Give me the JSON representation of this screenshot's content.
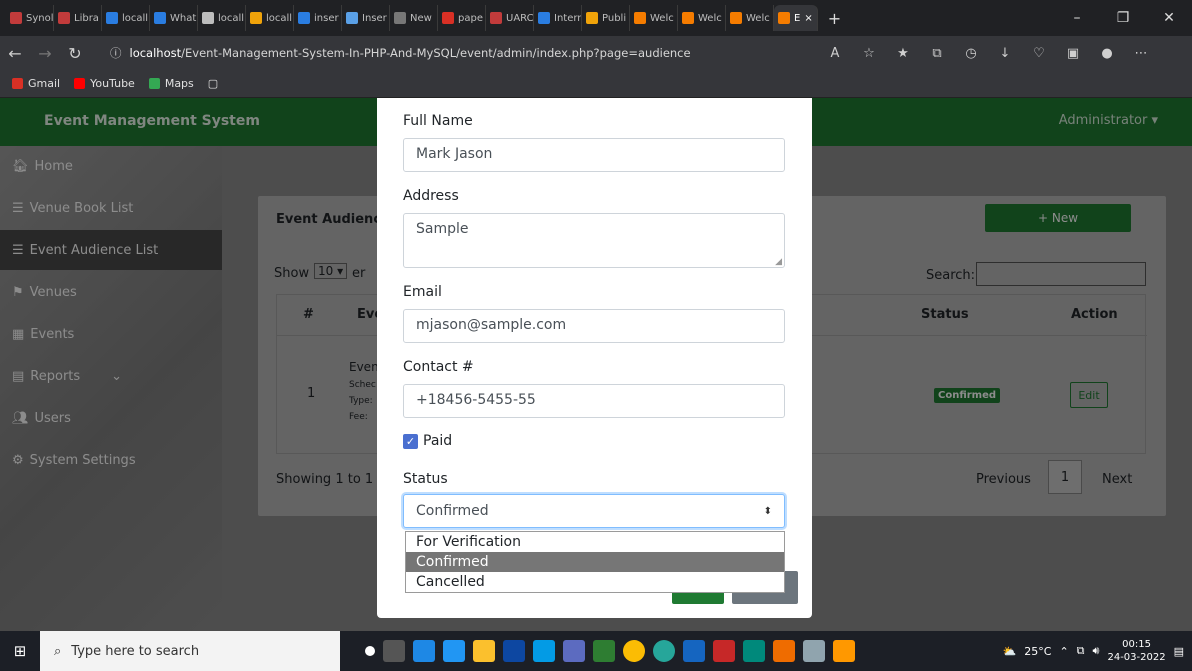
{
  "browser": {
    "tabs": [
      {
        "label": "Synol",
        "color": "#c23b3b"
      },
      {
        "label": "Libra",
        "color": "#c23b3b"
      },
      {
        "label": "locall",
        "color": "#2a7de1"
      },
      {
        "label": "What",
        "color": "#2a7de1"
      },
      {
        "label": "locall",
        "color": "#bdbdbd"
      },
      {
        "label": "locall",
        "color": "#f0a30a"
      },
      {
        "label": "inser",
        "color": "#2a7de1"
      },
      {
        "label": "Inser",
        "color": "#5aa0e6"
      },
      {
        "label": "New",
        "color": "#777777"
      },
      {
        "label": "pape",
        "color": "#d93025"
      },
      {
        "label": "UARC",
        "color": "#c23b3b"
      },
      {
        "label": "Intern",
        "color": "#2a7de1"
      },
      {
        "label": "Publi",
        "color": "#f0a30a"
      },
      {
        "label": "Welc",
        "color": "#f57c00"
      },
      {
        "label": "Welc",
        "color": "#f57c00"
      },
      {
        "label": "Welc",
        "color": "#f57c00"
      }
    ],
    "active_tab": {
      "label": "E",
      "close": "×"
    },
    "new_tab": "+",
    "window_controls": {
      "minimize": "–",
      "restore": "❐",
      "close": "✕"
    },
    "url_host": "localhost",
    "url_path": "/Event-Management-System-In-PHP-And-MySQL/event/admin/index.php?page=audience",
    "bookmarks": [
      {
        "label": "Gmail",
        "color": "#d93025"
      },
      {
        "label": "YouTube",
        "color": "#ff0000"
      },
      {
        "label": "Maps",
        "color": "#34a853"
      }
    ]
  },
  "app": {
    "brand": "Event Management System",
    "user_menu": "Administrator ▾",
    "sidebar": [
      {
        "label": "Home",
        "icon": "🏠︎"
      },
      {
        "label": "Venue Book List",
        "icon": "☰"
      },
      {
        "label": "Event Audience List",
        "icon": "☰"
      },
      {
        "label": "Venues",
        "icon": "⚑"
      },
      {
        "label": "Events",
        "icon": "▦"
      },
      {
        "label": "Reports",
        "icon": "▤"
      },
      {
        "label": "Users",
        "icon": "👥︎"
      },
      {
        "label": "System Settings",
        "icon": "⚙"
      }
    ],
    "card_title": "Event Audience",
    "new_button": "+ New",
    "show_label": "Show",
    "show_value": "10",
    "show_suffix": "er",
    "search_label": "Search:",
    "table_headers": {
      "num": "#",
      "event": "Eve",
      "status": "Status",
      "action": "Action"
    },
    "row": {
      "num": "1",
      "event": "Even",
      "schedule": "Schec",
      "type": "Type:",
      "fee": "Fee: ",
      "status": "Confirmed",
      "action": "Edit"
    },
    "showing_info": "Showing 1 to 1 o",
    "pagination": {
      "prev": "Previous",
      "page": "1",
      "next": "Next"
    }
  },
  "modal": {
    "full_name_label": "Full Name",
    "full_name_value": "Mark Jason",
    "address_label": "Address",
    "address_value": "Sample",
    "email_label": "Email",
    "email_value": "mjason@sample.com",
    "contact_label": "Contact #",
    "contact_value": "+18456-5455-55",
    "paid_label": "Paid",
    "paid_checked": true,
    "status_label": "Status",
    "status_value": "Confirmed",
    "status_options": [
      "For Verification",
      "Confirmed",
      "Cancelled"
    ]
  },
  "taskbar": {
    "search_placeholder": "Type here to search",
    "weather": "25°C",
    "time": "00:15",
    "date": "24-03-2022"
  }
}
